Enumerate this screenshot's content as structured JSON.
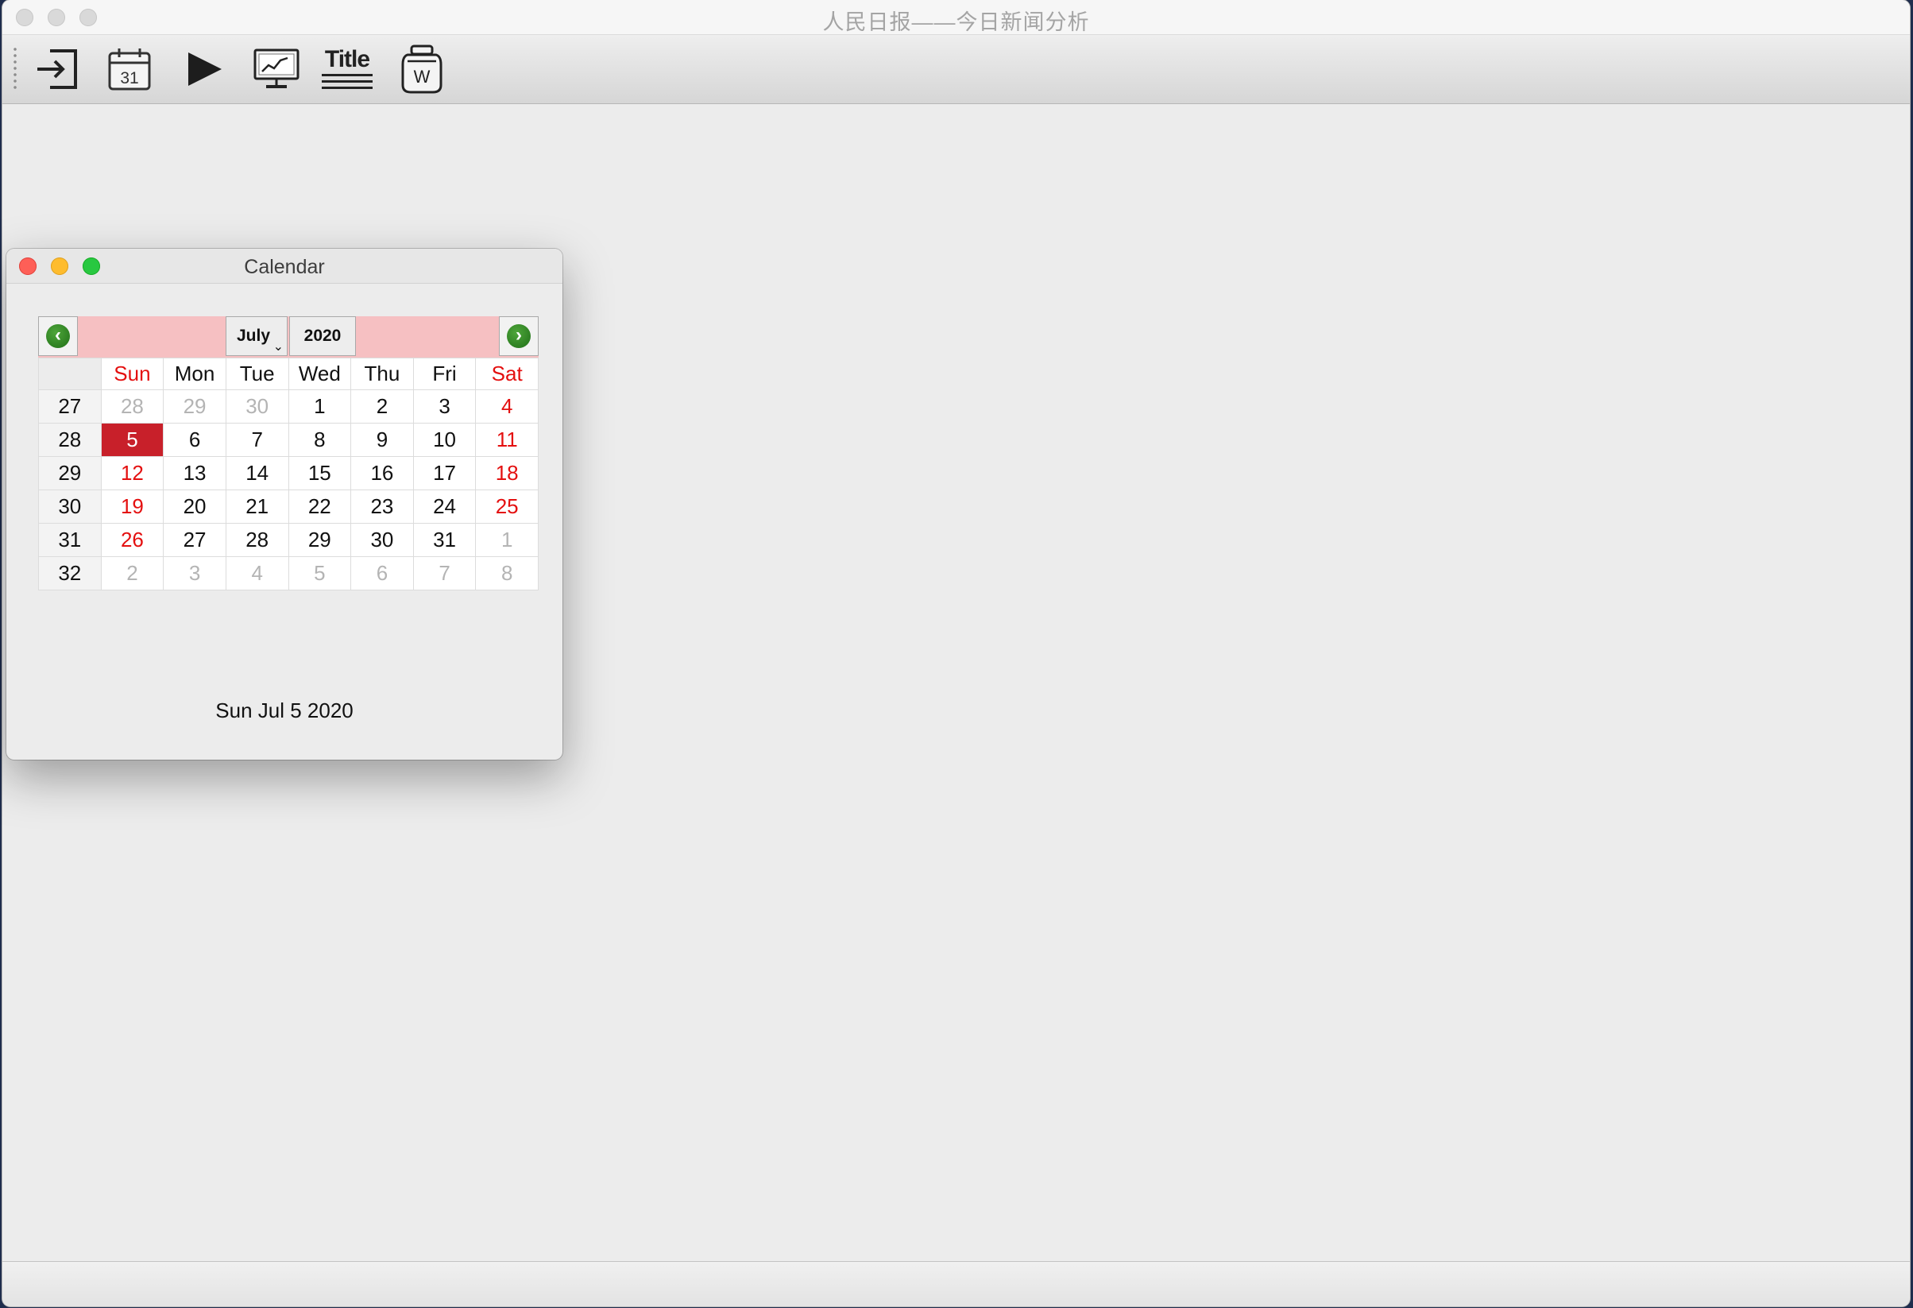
{
  "app": {
    "title": "人民日报——今日新闻分析",
    "toolbar": [
      {
        "name": "import-button",
        "icon": "import-arrow-icon"
      },
      {
        "name": "calendar-button",
        "icon": "calendar-icon",
        "day": "31"
      },
      {
        "name": "run-button",
        "icon": "play-icon"
      },
      {
        "name": "chart-button",
        "icon": "monitor-chart-icon"
      },
      {
        "name": "title-button",
        "icon": "title-lines-icon",
        "label": "Title"
      },
      {
        "name": "word-button",
        "icon": "word-jar-icon",
        "label": "W"
      }
    ]
  },
  "calendar_window": {
    "title": "Calendar",
    "month": "July",
    "year": "2020",
    "weekdays": [
      "Sun",
      "Mon",
      "Tue",
      "Wed",
      "Thu",
      "Fri",
      "Sat"
    ],
    "weeks": [
      {
        "week": "27",
        "days": [
          {
            "d": "28",
            "t": "other"
          },
          {
            "d": "29",
            "t": "other"
          },
          {
            "d": "30",
            "t": "other"
          },
          {
            "d": "1",
            "t": "normal"
          },
          {
            "d": "2",
            "t": "normal"
          },
          {
            "d": "3",
            "t": "normal"
          },
          {
            "d": "4",
            "t": "weekend"
          }
        ]
      },
      {
        "week": "28",
        "days": [
          {
            "d": "5",
            "t": "selected"
          },
          {
            "d": "6",
            "t": "normal"
          },
          {
            "d": "7",
            "t": "normal"
          },
          {
            "d": "8",
            "t": "normal"
          },
          {
            "d": "9",
            "t": "normal"
          },
          {
            "d": "10",
            "t": "normal"
          },
          {
            "d": "11",
            "t": "weekend"
          }
        ]
      },
      {
        "week": "29",
        "days": [
          {
            "d": "12",
            "t": "weekend"
          },
          {
            "d": "13",
            "t": "normal"
          },
          {
            "d": "14",
            "t": "normal"
          },
          {
            "d": "15",
            "t": "normal"
          },
          {
            "d": "16",
            "t": "normal"
          },
          {
            "d": "17",
            "t": "normal"
          },
          {
            "d": "18",
            "t": "weekend"
          }
        ]
      },
      {
        "week": "30",
        "days": [
          {
            "d": "19",
            "t": "weekend"
          },
          {
            "d": "20",
            "t": "normal"
          },
          {
            "d": "21",
            "t": "normal"
          },
          {
            "d": "22",
            "t": "normal"
          },
          {
            "d": "23",
            "t": "normal"
          },
          {
            "d": "24",
            "t": "normal"
          },
          {
            "d": "25",
            "t": "weekend"
          }
        ]
      },
      {
        "week": "31",
        "days": [
          {
            "d": "26",
            "t": "weekend"
          },
          {
            "d": "27",
            "t": "normal"
          },
          {
            "d": "28",
            "t": "normal"
          },
          {
            "d": "29",
            "t": "normal"
          },
          {
            "d": "30",
            "t": "normal"
          },
          {
            "d": "31",
            "t": "normal"
          },
          {
            "d": "1",
            "t": "other"
          }
        ]
      },
      {
        "week": "32",
        "days": [
          {
            "d": "2",
            "t": "other"
          },
          {
            "d": "3",
            "t": "other"
          },
          {
            "d": "4",
            "t": "other"
          },
          {
            "d": "5",
            "t": "other"
          },
          {
            "d": "6",
            "t": "other"
          },
          {
            "d": "7",
            "t": "other"
          },
          {
            "d": "8",
            "t": "other"
          }
        ]
      }
    ],
    "selected_date_text": "Sun Jul 5 2020"
  },
  "colors": {
    "weekend": "#e41010",
    "selected": "#c8202a",
    "nav_bar": "#f6c0c2",
    "nav_arrow": "#2e8a24"
  }
}
